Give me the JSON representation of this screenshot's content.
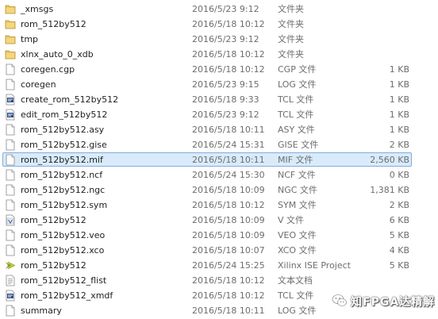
{
  "colors": {
    "folder": "#e8c25a",
    "selection_fill": "#d9ebfb",
    "selection_border": "#84acdd",
    "secondary_text": "#6d6d6d"
  },
  "files": [
    {
      "name": "_xmsgs",
      "date": "2016/5/23 9:12",
      "type": "文件夹",
      "size": "",
      "icon": "folder-icon"
    },
    {
      "name": "rom_512by512",
      "date": "2016/5/18 10:12",
      "type": "文件夹",
      "size": "",
      "icon": "folder-icon"
    },
    {
      "name": "tmp",
      "date": "2016/5/23 9:12",
      "type": "文件夹",
      "size": "",
      "icon": "folder-icon"
    },
    {
      "name": "xlnx_auto_0_xdb",
      "date": "2016/5/18 10:12",
      "type": "文件夹",
      "size": "",
      "icon": "folder-icon"
    },
    {
      "name": "coregen.cgp",
      "date": "2016/5/18 10:12",
      "type": "CGP 文件",
      "size": "1 KB",
      "icon": "file-icon"
    },
    {
      "name": "coregen",
      "date": "2016/5/23 9:15",
      "type": "LOG 文件",
      "size": "1 KB",
      "icon": "file-icon"
    },
    {
      "name": "create_rom_512by512",
      "date": "2016/5/18 9:33",
      "type": "TCL 文件",
      "size": "1 KB",
      "icon": "tcl-icon"
    },
    {
      "name": "edit_rom_512by512",
      "date": "2016/5/23 9:12",
      "type": "TCL 文件",
      "size": "1 KB",
      "icon": "tcl-icon"
    },
    {
      "name": "rom_512by512.asy",
      "date": "2016/5/18 10:11",
      "type": "ASY 文件",
      "size": "1 KB",
      "icon": "file-icon"
    },
    {
      "name": "rom_512by512.gise",
      "date": "2016/5/24 15:31",
      "type": "GISE 文件",
      "size": "2 KB",
      "icon": "file-icon"
    },
    {
      "name": "rom_512by512.mif",
      "date": "2016/5/18 10:11",
      "type": "MIF 文件",
      "size": "2,560 KB",
      "icon": "file-icon",
      "selected": true
    },
    {
      "name": "rom_512by512.ncf",
      "date": "2016/5/24 15:30",
      "type": "NCF 文件",
      "size": "0 KB",
      "icon": "file-icon"
    },
    {
      "name": "rom_512by512.ngc",
      "date": "2016/5/18 10:09",
      "type": "NGC 文件",
      "size": "1,381 KB",
      "icon": "file-icon"
    },
    {
      "name": "rom_512by512.sym",
      "date": "2016/5/18 10:12",
      "type": "SYM 文件",
      "size": "2 KB",
      "icon": "file-icon"
    },
    {
      "name": "rom_512by512",
      "date": "2016/5/18 10:09",
      "type": "V 文件",
      "size": "6 KB",
      "icon": "v-file-icon"
    },
    {
      "name": "rom_512by512.veo",
      "date": "2016/5/18 10:09",
      "type": "VEO 文件",
      "size": "5 KB",
      "icon": "file-icon"
    },
    {
      "name": "rom_512by512.xco",
      "date": "2016/5/18 10:07",
      "type": "XCO 文件",
      "size": "4 KB",
      "icon": "file-icon"
    },
    {
      "name": "rom_512by512",
      "date": "2016/5/24 15:25",
      "type": "Xilinx ISE Project",
      "size": "5 KB",
      "icon": "xilinx-project-icon"
    },
    {
      "name": "rom_512by512_flist",
      "date": "2016/5/18 10:12",
      "type": "文本文档",
      "size": "",
      "icon": "text-file-icon"
    },
    {
      "name": "rom_512by512_xmdf",
      "date": "2016/5/18 10:12",
      "type": "TCL 文件",
      "size": "",
      "icon": "tcl-icon"
    },
    {
      "name": "summary",
      "date": "2016/5/18 10:11",
      "type": "LOG 文件",
      "size": "",
      "icon": "file-icon"
    }
  ],
  "watermark": {
    "text": "知FPGA达精解",
    "icon": "wechat-logo-icon"
  }
}
